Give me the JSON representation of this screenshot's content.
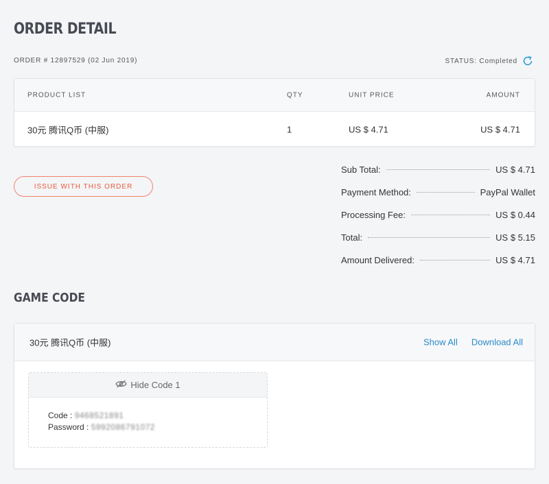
{
  "page": {
    "title": "ORDER DETAIL"
  },
  "order": {
    "number_line": "ORDER # 12897529 (02 Jun 2019)",
    "status_label": "STATUS: Completed"
  },
  "product_table": {
    "headers": {
      "name": "PRODUCT LIST",
      "qty": "QTY",
      "unit_price": "UNIT PRICE",
      "amount": "AMOUNT"
    },
    "rows": [
      {
        "name": "30元 腾讯Q币 (中服)",
        "qty": "1",
        "unit_price": "US $ 4.71",
        "amount": "US $ 4.71"
      }
    ]
  },
  "issue_button": {
    "label": "ISSUE WITH THIS ORDER"
  },
  "summary": [
    {
      "label": "Sub Total:",
      "value": "US $ 4.71"
    },
    {
      "label": "Payment Method:",
      "value": "PayPal Wallet"
    },
    {
      "label": "Processing Fee:",
      "value": "US $ 0.44"
    },
    {
      "label": "Total:",
      "value": "US $ 5.15"
    },
    {
      "label": "Amount Delivered:",
      "value": "US $ 4.71"
    }
  ],
  "game_code": {
    "section_title": "GAME CODE",
    "product_name": "30元 腾讯Q币 (中服)",
    "show_all": "Show All",
    "download_all": "Download All",
    "hide_code_label": "Hide Code 1",
    "code_label": "Code :",
    "code_value": "9468521891",
    "password_label": "Password :",
    "password_value": "5992086791072"
  },
  "colors": {
    "accent_link": "#2a8ac9",
    "issue_red": "#e8593b",
    "refresh_blue": "#2a9fd6"
  },
  "icons": {
    "status": "refresh-icon",
    "hide_code": "eye-slash-icon"
  }
}
